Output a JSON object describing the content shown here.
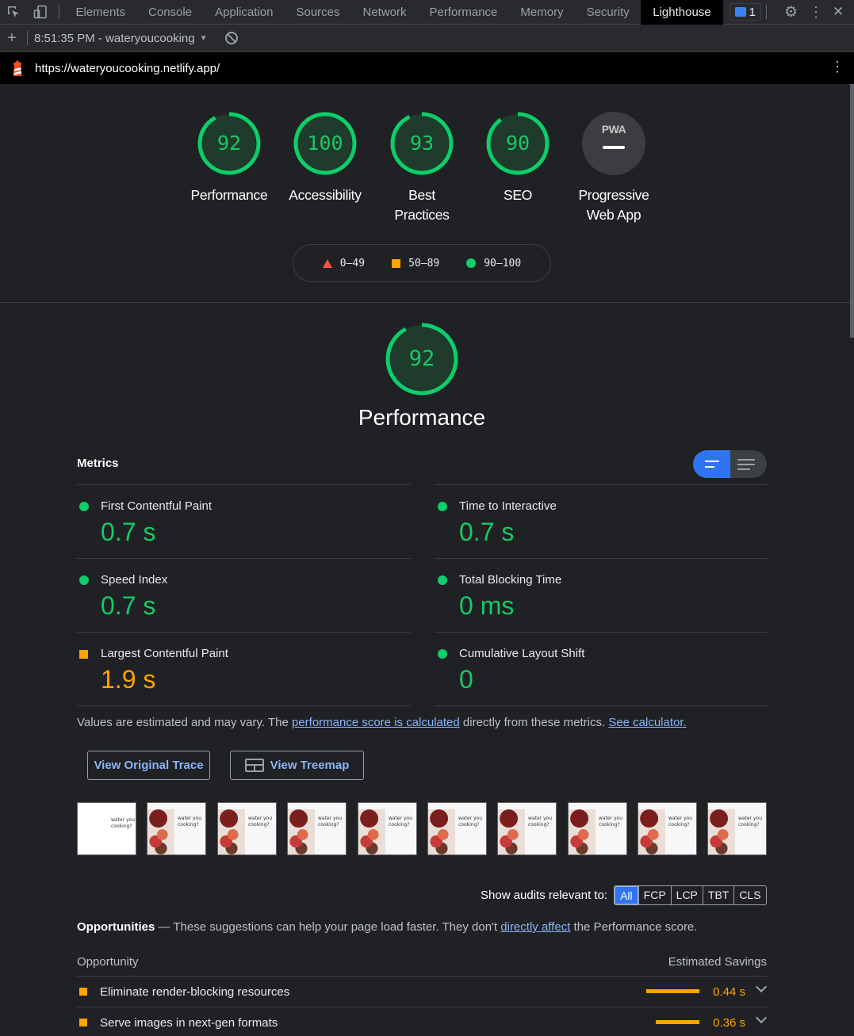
{
  "devtools": {
    "tabs": [
      "Elements",
      "Console",
      "Application",
      "Sources",
      "Network",
      "Performance",
      "Memory",
      "Security",
      "Lighthouse"
    ],
    "active_tab": "Lighthouse",
    "issues_count": "1"
  },
  "toolbar": {
    "report_label": "8:51:35 PM - wateryoucooking"
  },
  "url": "https://wateryoucooking.netlify.app/",
  "gauges": [
    {
      "score": "92",
      "label": "Performance",
      "fraction": 0.92
    },
    {
      "score": "100",
      "label": "Accessibility",
      "fraction": 1.0
    },
    {
      "score": "93",
      "label": "Best Practices",
      "fraction": 0.93
    },
    {
      "score": "90",
      "label": "SEO",
      "fraction": 0.9
    },
    {
      "score": "PWA",
      "label": "Progressive Web App",
      "fraction": 0
    }
  ],
  "legend": {
    "fail": "0–49",
    "average": "50–89",
    "pass": "90–100"
  },
  "performance": {
    "score": "92",
    "fraction": 0.92,
    "title": "Performance",
    "metrics_title": "Metrics",
    "metrics": [
      {
        "name": "First Contentful Paint",
        "value": "0.7 s",
        "rating": "pass"
      },
      {
        "name": "Time to Interactive",
        "value": "0.7 s",
        "rating": "pass"
      },
      {
        "name": "Speed Index",
        "value": "0.7 s",
        "rating": "pass"
      },
      {
        "name": "Total Blocking Time",
        "value": "0 ms",
        "rating": "pass"
      },
      {
        "name": "Largest Contentful Paint",
        "value": "1.9 s",
        "rating": "average"
      },
      {
        "name": "Cumulative Layout Shift",
        "value": "0",
        "rating": "pass"
      }
    ],
    "note_prefix": "Values are estimated and may vary. The ",
    "note_link1": "performance score is calculated",
    "note_middle": " directly from these metrics. ",
    "note_link2": "See calculator.",
    "btn_trace": "View Original Trace",
    "btn_treemap": "View Treemap",
    "filmstrip_text": "water you cooking?",
    "filter_label": "Show audits relevant to:",
    "filter_chips": [
      "All",
      "FCP",
      "LCP",
      "TBT",
      "CLS"
    ],
    "opp_title": "Opportunities",
    "opp_desc_prefix": " — These suggestions can help your page load faster. They don't ",
    "opp_desc_link": "directly affect",
    "opp_desc_suffix": " the Performance score.",
    "opp_col_left": "Opportunity",
    "opp_col_right": "Estimated Savings",
    "opportunities": [
      {
        "name": "Eliminate render-blocking resources",
        "savings": "0.44 s",
        "savings_s": 0.44
      },
      {
        "name": "Serve images in next-gen formats",
        "savings": "0.36 s",
        "savings_s": 0.36
      }
    ]
  },
  "colors": {
    "pass": "#0cce6b",
    "average": "#ffa400",
    "fail": "#ff4e42",
    "accent": "#3174f1"
  }
}
